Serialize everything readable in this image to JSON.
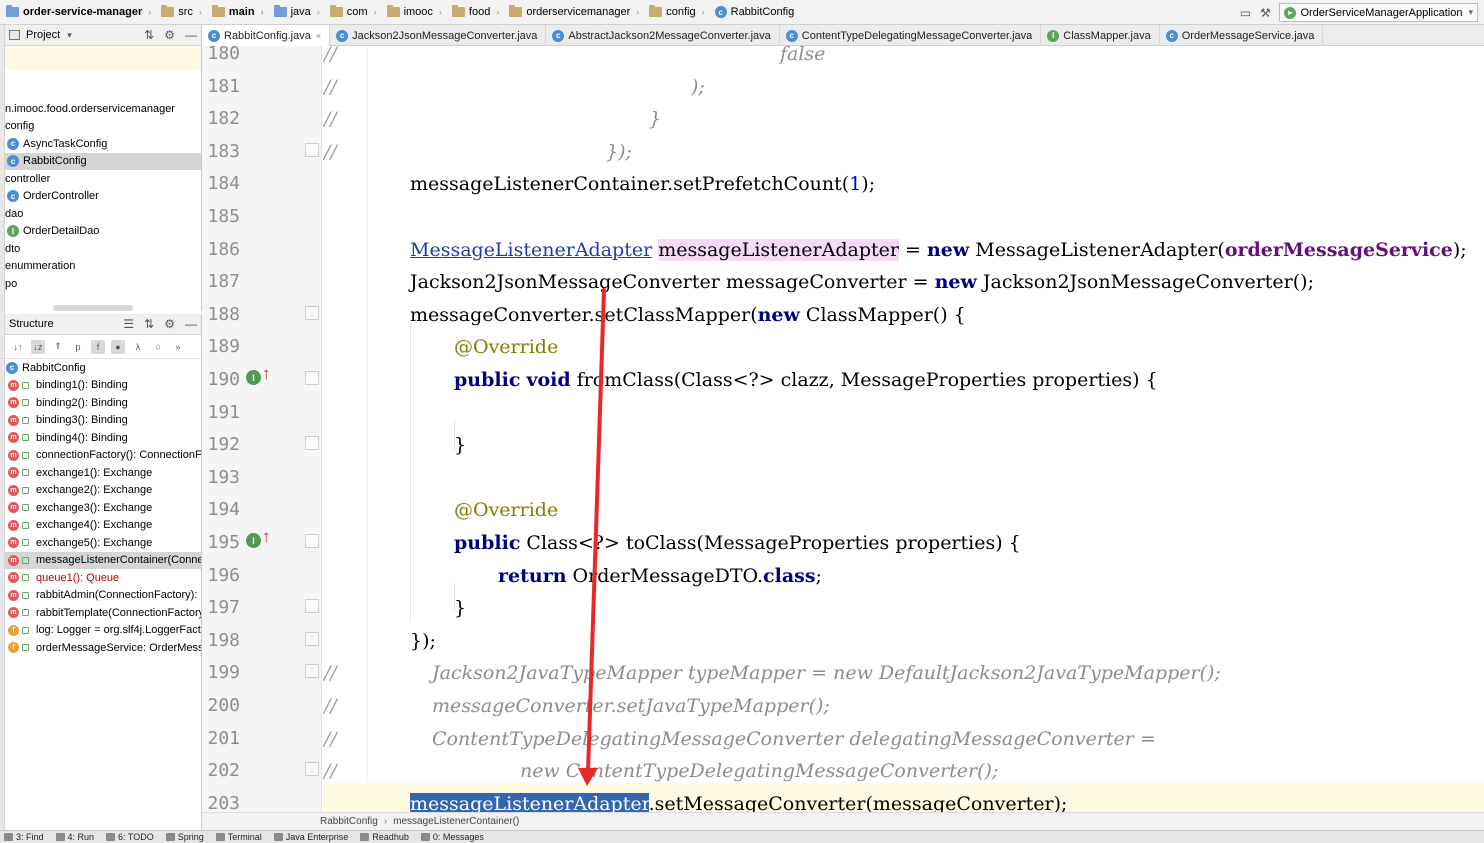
{
  "navbar": {
    "crumbs": [
      "order-service-manager",
      "src",
      "main",
      "java",
      "com",
      "imooc",
      "food",
      "orderservicemanager",
      "config",
      "RabbitConfig"
    ],
    "run_config": "OrderServiceManagerApplication"
  },
  "project_panel": {
    "title": "Project",
    "tree": [
      "n.imooc.food.orderservicemanager",
      "config",
      "AsyncTaskConfig",
      "RabbitConfig",
      "controller",
      "OrderController",
      "dao",
      "OrderDetailDao",
      "dto",
      "enummeration",
      "po"
    ]
  },
  "structure_panel": {
    "title": "Structure",
    "root": "RabbitConfig",
    "members": [
      "binding1(): Binding",
      "binding2(): Binding",
      "binding3(): Binding",
      "binding4(): Binding",
      "connectionFactory(): ConnectionFa",
      "exchange1(): Exchange",
      "exchange2(): Exchange",
      "exchange3(): Exchange",
      "exchange4(): Exchange",
      "exchange5(): Exchange",
      "messageListenerContainer(Connec",
      "queue1(): Queue",
      "rabbitAdmin(ConnectionFactory): F",
      "rabbitTemplate(ConnectionFactory",
      "log: Logger = org.slf4j.LoggerFact",
      "orderMessageService: OrderMess"
    ]
  },
  "tabs": [
    "RabbitConfig.java",
    "Jackson2JsonMessageConverter.java",
    "AbstractJackson2MessageConverter.java",
    "ContentTypeDelegatingMessageConverter.java",
    "ClassMapper.java",
    "OrderMessageService.java"
  ],
  "line_numbers": [
    "180",
    "181",
    "182",
    "183",
    "184",
    "185",
    "186",
    "187",
    "188",
    "189",
    "190",
    "191",
    "192",
    "193",
    "194",
    "195",
    "196",
    "197",
    "198",
    "199",
    "200",
    "201",
    "202",
    "203"
  ],
  "code": {
    "l180": "false",
    "l181": ");",
    "l182": "}",
    "l183": "});",
    "l184_a": "messageListenerContainer.setPrefetchCount(",
    "l184_num": "1",
    "l184_b": ");",
    "l186_type": "MessageListenerAdapter",
    "l186_var": "messageListenerAdapter",
    "l186_eq": " = ",
    "l186_new": "new",
    "l186_ctor": " MessageListenerAdapter(",
    "l186_fld": "orderMessageService",
    "l186_end": ");",
    "l187_a": "Jackson2JsonMessageConverter messageConverter = ",
    "l187_new": "new",
    "l187_b": " Jackson2JsonMessageConverter();",
    "l188_a": "messageConverter.setClassMapper(",
    "l188_new": "new",
    "l188_b": " ClassMapper() {",
    "l189": "@Override",
    "l190_pub": "public",
    "l190_void": "void",
    "l190_b": " fromClass(Class<?> clazz, MessageProperties properties) {",
    "l192": "}",
    "l194": "@Override",
    "l195_pub": "public",
    "l195_b": " Class<?> toClass(MessageProperties properties) {",
    "l196_ret": "return",
    "l196_b": " OrderMessageDTO.",
    "l196_cls": "class",
    "l196_c": ";",
    "l197": "}",
    "l198": "});",
    "l199": "Jackson2JavaTypeMapper typeMapper = new DefaultJackson2JavaTypeMapper();",
    "l200": "messageConverter.setJavaTypeMapper();",
    "l201": "ContentTypeDelegatingMessageConverter delegatingMessageConverter =",
    "l202": "new ContentTypeDelegatingMessageConverter();",
    "l203_sel": "messageListenerAdapter",
    "l203_b": ".setMessageConverter(messageConverter);"
  },
  "comment_marker": "//",
  "editor_breadcrumb": [
    "RabbitConfig",
    "messageListenerContainer()"
  ],
  "bottom_tools": [
    "3: Find",
    "4: Run",
    "6: TODO",
    "Spring",
    "Terminal",
    "Java Enterprise",
    "Readhub",
    "0: Messages"
  ],
  "colors": {
    "keyword": "#00007f",
    "number": "#0000ff",
    "annotation": "#7f7f00",
    "field": "#660e7a",
    "comment": "#8c8c8c",
    "selection": "#3466b0",
    "annotation_arrow": "#e8292a"
  }
}
